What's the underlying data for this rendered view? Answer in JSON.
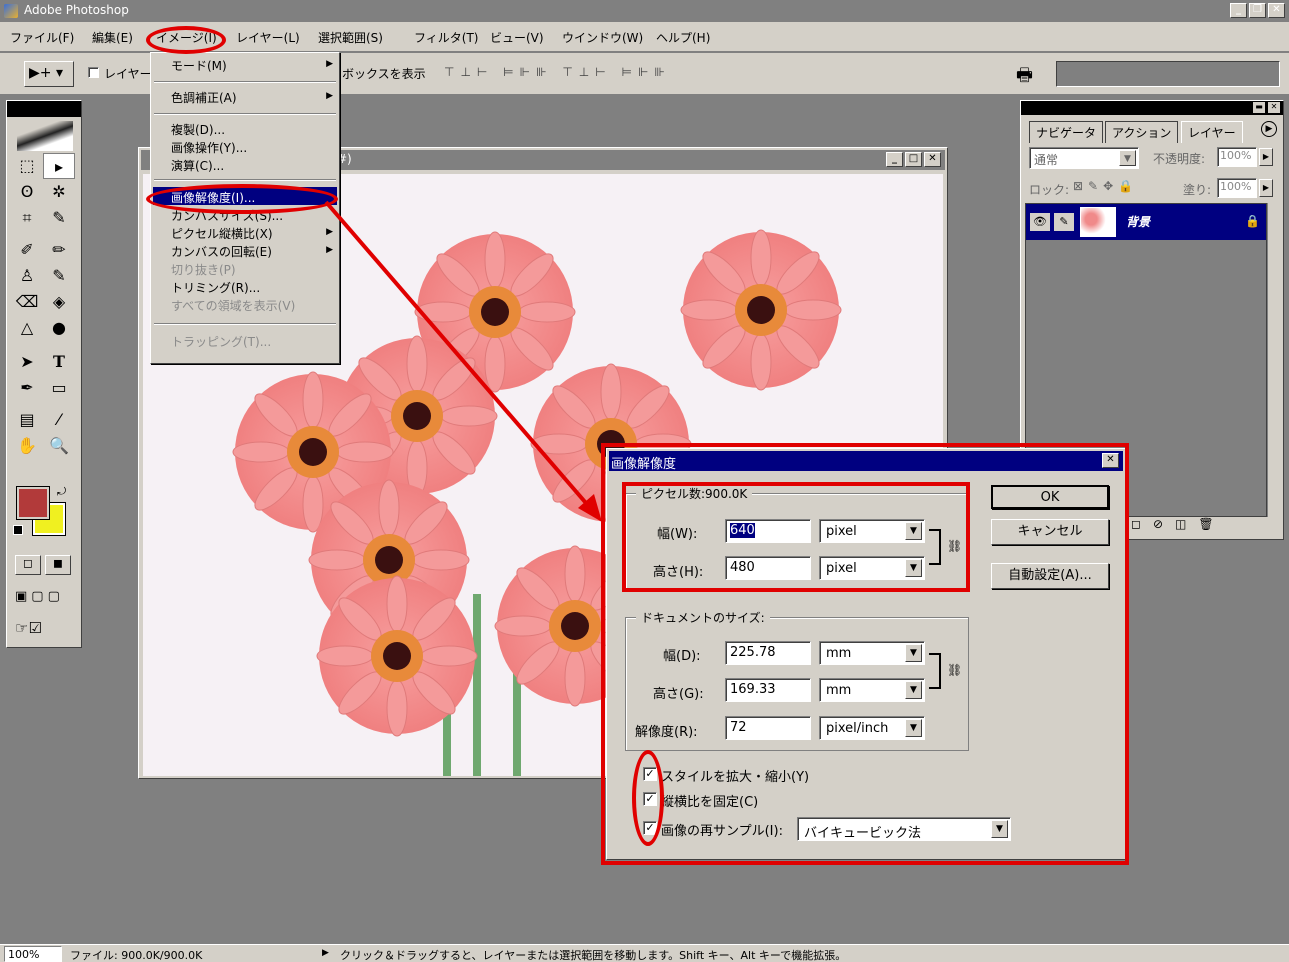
{
  "app": {
    "title": "Adobe Photoshop"
  },
  "menubar": {
    "items": [
      "ファイル(F)",
      "編集(E)",
      "イメージ(I)",
      "レイヤー(L)",
      "選択範囲(S)",
      "フィルタ(T)",
      "ビュー(V)",
      "ウインドウ(W)",
      "ヘルプ(H)"
    ]
  },
  "optionsbar": {
    "layer_label": "レイヤー",
    "show_box_label": "ボックスを表示"
  },
  "image_menu": {
    "mode": "モード(M)",
    "adjust": "色調補正(A)",
    "duplicate": "複製(D)...",
    "apply_image": "画像操作(Y)...",
    "calculations": "演算(C)...",
    "image_size": "画像解像度(I)...",
    "canvas_size": "カンバスサイズ(S)...",
    "pixel_aspect": "ピクセル縦横比(X)",
    "rotate_canvas": "カンバスの回転(E)",
    "crop": "切り抜き(P)",
    "trim": "トリミング(R)...",
    "reveal_all": "すべての領域を表示(V)",
    "trap": "トラッピング(T)..."
  },
  "document": {
    "title_fragment": "#)"
  },
  "dialog": {
    "title": "画像解像度",
    "pixel_group": "ピクセル数:900.0K",
    "width_label": "幅(W):",
    "width_value": "640",
    "width_unit": "pixel",
    "height_label": "高さ(H):",
    "height_value": "480",
    "height_unit": "pixel",
    "doc_group": "ドキュメントのサイズ:",
    "doc_width_label": "幅(D):",
    "doc_width_value": "225.78",
    "doc_width_unit": "mm",
    "doc_height_label": "高さ(G):",
    "doc_height_value": "169.33",
    "doc_height_unit": "mm",
    "res_label": "解像度(R):",
    "res_value": "72",
    "res_unit": "pixel/inch",
    "scale_styles": "スタイルを拡大・縮小(Y)",
    "constrain": "縦横比を固定(C)",
    "resample": "画像の再サンプル(I):",
    "resample_method": "バイキュービック法",
    "ok": "OK",
    "cancel": "キャンセル",
    "auto": "自動設定(A)..."
  },
  "layers_panel": {
    "tabs": [
      "ナビゲータ",
      "アクション",
      "レイヤー"
    ],
    "blend_mode": "通常",
    "opacity_label": "不透明度:",
    "opacity_value": "100%",
    "lock_label": "ロック:",
    "fill_label": "塗り:",
    "fill_value": "100%",
    "layer_name": "背景"
  },
  "status": {
    "zoom": "100%",
    "file_info": "ファイル: 900.0K/900.0K",
    "hint": "クリック＆ドラッグすると、レイヤーまたは選択範囲を移動します。Shift キー、Alt キーで機能拡張。"
  },
  "colors": {
    "foreground": "#b23a3a",
    "background": "#f0f020",
    "annotation": "#e00000",
    "flower": "#f08a8a"
  }
}
